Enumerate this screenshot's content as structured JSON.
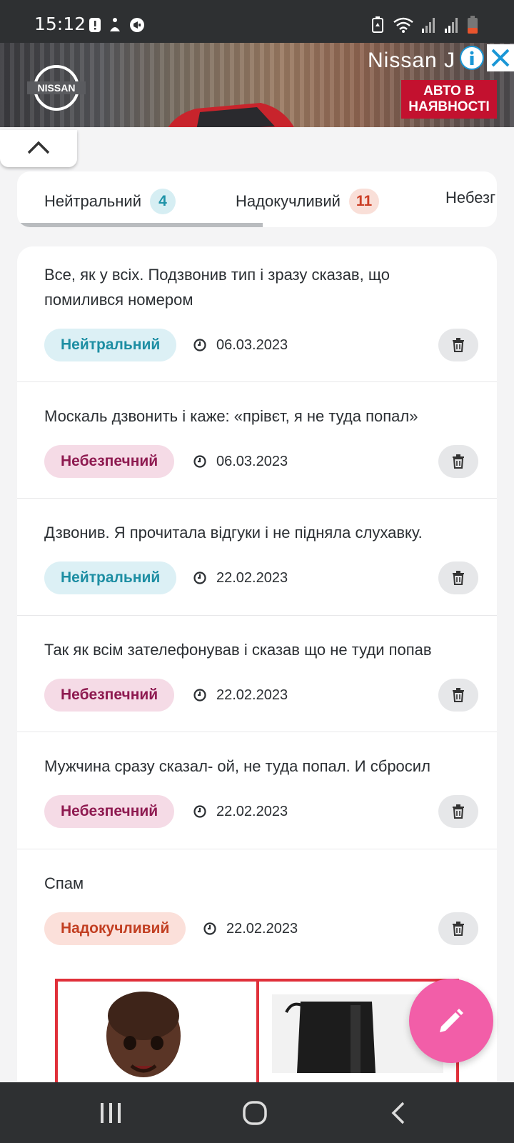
{
  "status_bar": {
    "time": "15:12"
  },
  "ad_banner": {
    "brand": "NISSAN",
    "headline": "Nissan J",
    "cta_line1": "АВТО В",
    "cta_line2": "НАЯВНОСТІ"
  },
  "tabs": [
    {
      "label": "Нейтральний",
      "count": "4",
      "color": "#1f93a8"
    },
    {
      "label": "Надокучливий",
      "count": "11",
      "color": "#cc3e25"
    },
    {
      "label": "Небезг"
    }
  ],
  "reviews": [
    {
      "text": "Все, як у всіх. Подзвонив тип і зразу сказав, що помилився номером",
      "category": "Нейтральний",
      "date": "06.03.2023"
    },
    {
      "text": "Москаль дзвонить і каже: «прівєт, я не туда попал»",
      "category": "Небезпечний",
      "date": "06.03.2023"
    },
    {
      "text": "Дзвонив. Я прочитала відгуки і не підняла слухавку.",
      "category": "Нейтральний",
      "date": "22.02.2023"
    },
    {
      "text": "Так як всім зателефонував і сказав що не туди попав",
      "category": "Небезпечний",
      "date": "22.02.2023"
    },
    {
      "text": "Мужчина сразу сказал- ой, не туда попал. И сбросил",
      "category": "Небезпечний",
      "date": "22.02.2023"
    },
    {
      "text": "Спам",
      "category": "Надокучливий",
      "date": "22.02.2023"
    }
  ],
  "colors": {
    "neutral": "#1d8ea3",
    "danger": "#8e1a50",
    "annoying": "#c23f22",
    "fab": "#f25ea8"
  }
}
